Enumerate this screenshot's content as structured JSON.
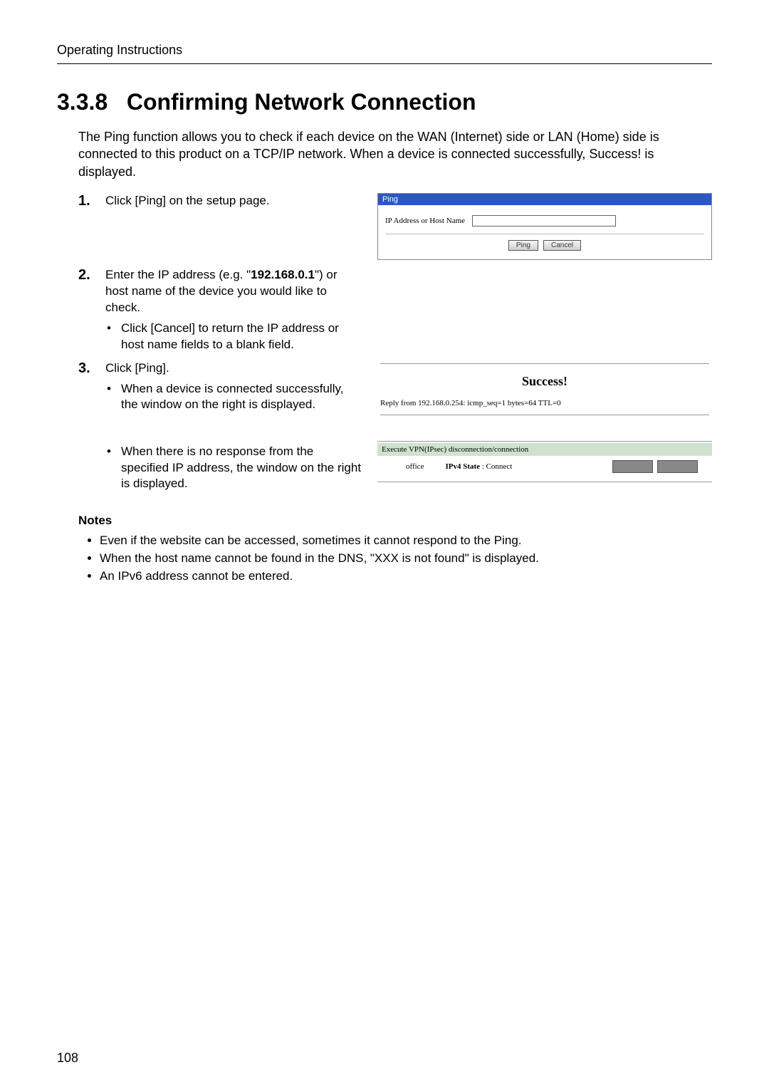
{
  "doc": {
    "running_head": "Operating Instructions",
    "page_number": "108",
    "section_number": "3.3.8",
    "section_title": "Confirming Network Connection",
    "intro": "The Ping function allows you to check if each device on the WAN (Internet) side or LAN (Home) side is connected to this product on a TCP/IP network. When a device is connected successfully, Success! is displayed."
  },
  "steps": {
    "s1": {
      "num": "1.",
      "text": "Click [Ping] on the setup page."
    },
    "s2": {
      "num": "2.",
      "text_pre": "Enter the IP address (e.g. \"",
      "ip_bold": "192.168.0.1",
      "text_post": "\") or host name of the device you would like to check.",
      "sub": "Click [Cancel] to return the IP address or host name fields to a blank field."
    },
    "s3": {
      "num": "3.",
      "text": "Click [Ping].",
      "sub_a": "When a device is connected successfully, the window on the right is displayed.",
      "sub_b": "When there is no response from the specified IP address, the window on the right is displayed."
    }
  },
  "ping_panel": {
    "title": "Ping",
    "field_label": "IP Address or Host Name",
    "btn_ping": "Ping",
    "btn_cancel": "Cancel"
  },
  "success_panel": {
    "title": "Success!",
    "reply": "Reply from 192.168.0.254: icmp_seq=1 bytes=64 TTL=0"
  },
  "vpn_panel": {
    "header": "Execute VPN(IPsec) disconnection/connection",
    "name": "office",
    "state_label": "IPv4 State",
    "state_value": ": Connect"
  },
  "notes": {
    "title": "Notes",
    "items": [
      "Even if the website can be accessed, sometimes it cannot respond to the Ping.",
      "When the host name cannot be found in the DNS, \"XXX is not found\" is displayed.",
      "An IPv6 address cannot be entered."
    ]
  }
}
